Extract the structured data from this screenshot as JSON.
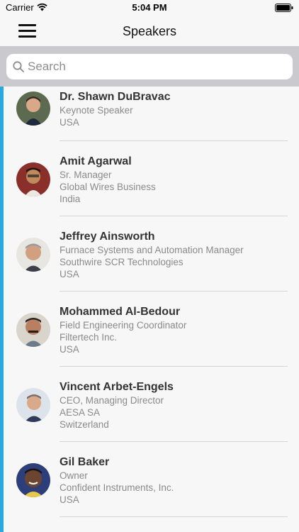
{
  "status_bar": {
    "carrier": "Carrier",
    "time": "5:04 PM"
  },
  "nav": {
    "title": "Speakers"
  },
  "search": {
    "placeholder": "Search",
    "value": ""
  },
  "speakers": [
    {
      "name": "Dr. Shawn DuBravac",
      "lines": [
        "Keynote Speaker",
        "USA"
      ]
    },
    {
      "name": "Amit Agarwal",
      "lines": [
        "Sr. Manager",
        "Global Wires Business",
        "India"
      ]
    },
    {
      "name": "Jeffrey Ainsworth",
      "lines": [
        "Furnace Systems and Automation Manager",
        "Southwire SCR Technologies",
        "USA"
      ]
    },
    {
      "name": "Mohammed Al-Bedour",
      "lines": [
        "Field Engineering Coordinator",
        "Filtertech Inc.",
        "USA"
      ]
    },
    {
      "name": "Vincent Arbet-Engels",
      "lines": [
        "CEO, Managing Director",
        "AESA SA",
        "Switzerland"
      ]
    },
    {
      "name": "Gil Baker",
      "lines": [
        "Owner",
        "Confident Instruments, Inc.",
        "USA"
      ]
    }
  ],
  "colors": {
    "accent": "#29a9e1",
    "search_band": "#c9c9ce"
  }
}
